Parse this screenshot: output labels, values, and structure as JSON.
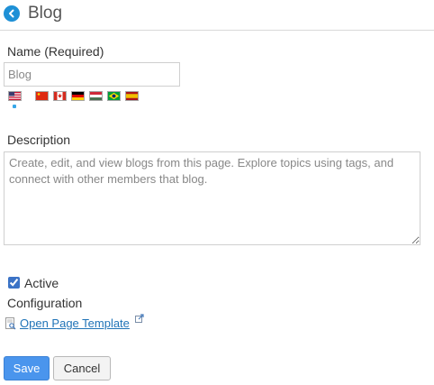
{
  "header": {
    "title": "Blog",
    "back_icon": "chevron-left-icon"
  },
  "form": {
    "name_label": "Name (Required)",
    "name_value": "Blog",
    "language_flags": [
      "us",
      "cn",
      "ca",
      "de",
      "hu",
      "br",
      "es"
    ],
    "description_label": "Description",
    "description_value": "Create, edit, and view blogs from this page. Explore topics using tags, and connect with other members that blog.",
    "active_label": "Active",
    "active_checked": true,
    "configuration_label": "Configuration",
    "template_link": "Open Page Template"
  },
  "buttons": {
    "save": "Save",
    "cancel": "Cancel"
  },
  "colors": {
    "accent": "#1e90d6",
    "link": "#1f73b7",
    "save_button": "#4a95ed"
  }
}
